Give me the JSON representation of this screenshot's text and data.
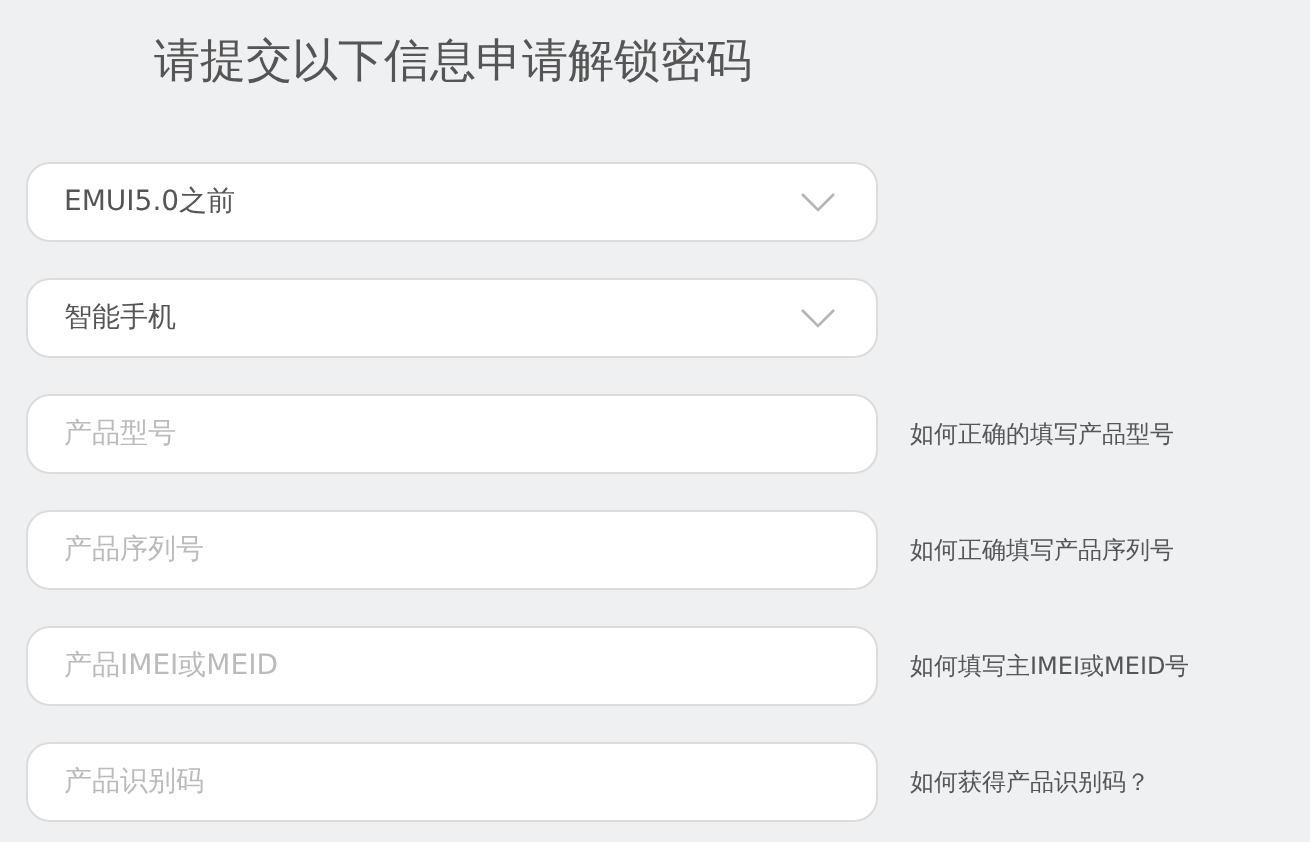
{
  "title": "请提交以下信息申请解锁密码",
  "fields": [
    {
      "kind": "select",
      "value": "EMUI5.0之前"
    },
    {
      "kind": "select",
      "value": "智能手机"
    },
    {
      "kind": "input",
      "placeholder": "产品型号",
      "help": "如何正确的填写产品型号"
    },
    {
      "kind": "input",
      "placeholder": "产品序列号",
      "help": "如何正确填写产品序列号"
    },
    {
      "kind": "input",
      "placeholder": "产品IMEI或MEID",
      "help": "如何填写主IMEI或MEID号"
    },
    {
      "kind": "input",
      "placeholder": "产品识别码",
      "help": "如何获得产品识别码？"
    }
  ]
}
